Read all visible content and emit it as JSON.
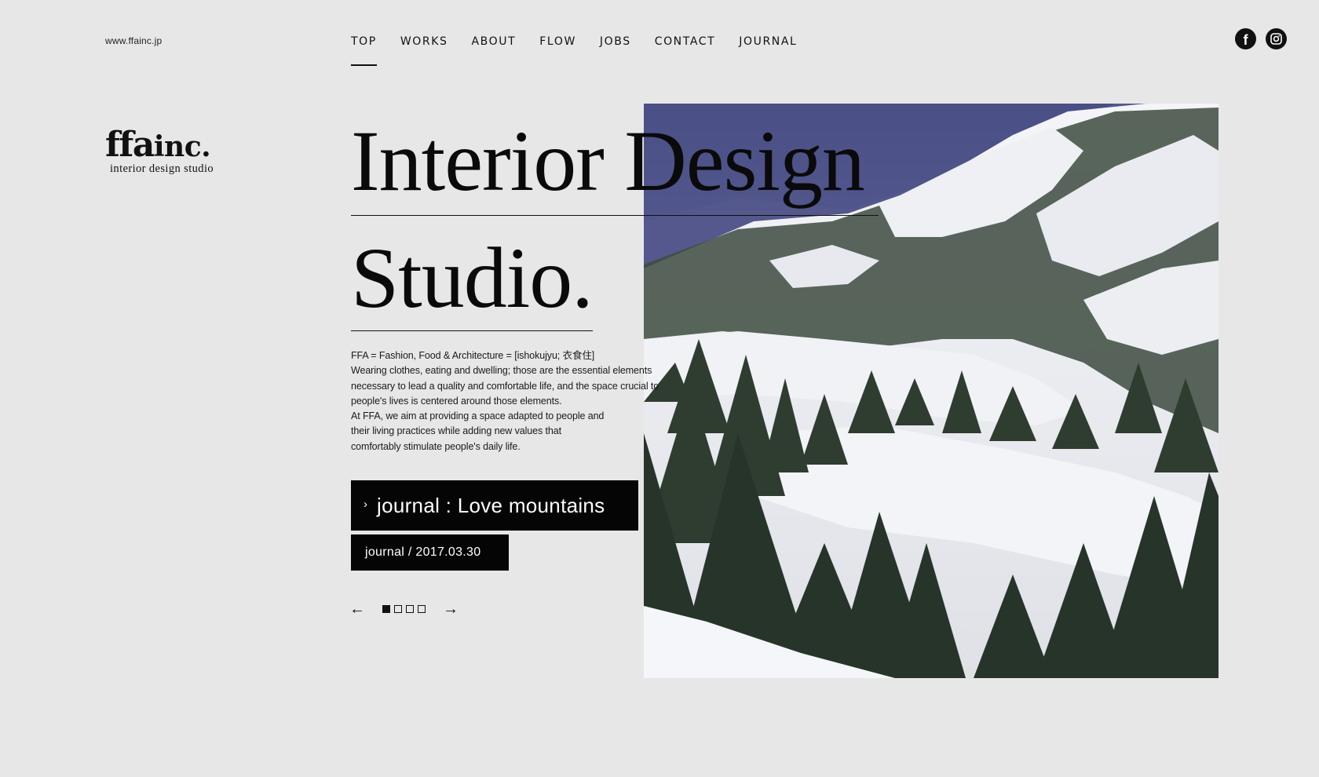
{
  "header": {
    "site_url": "www.ffainc.jp",
    "nav": [
      {
        "label": "TOP",
        "active": true
      },
      {
        "label": "WORKS"
      },
      {
        "label": "ABOUT"
      },
      {
        "label": "FLOW"
      },
      {
        "label": "JOBS"
      },
      {
        "label": "CONTACT"
      },
      {
        "label": "JOURNAL"
      }
    ],
    "social": [
      {
        "label": "f",
        "icon": "facebook-icon"
      },
      {
        "label": "",
        "icon": "instagram-icon"
      }
    ]
  },
  "logo": {
    "main": "ffa",
    "inc": "inc.",
    "sub": "interior design studio"
  },
  "hero": {
    "line1": "Interior Design",
    "line2": "Studio.",
    "photo": "snowy-mountain-forest-photo"
  },
  "intro": {
    "lines": [
      "FFA = Fashion, Food & Architecture = [ishokujyu; 衣食住]",
      "Wearing clothes, eating and dwelling; those are the essential elements",
      "necessary to lead a quality and comfortable life, and the space crucial to",
      "people's lives is centered around those elements.",
      "At FFA, we aim at providing a space adapted to people and",
      "their living practices while adding new values that",
      "comfortably stimulate people's daily life."
    ]
  },
  "journal": {
    "title": "journal : Love mountains",
    "meta": "journal / 2017.03.30",
    "chevron": "›"
  },
  "pager": {
    "prev": "←",
    "next": "→",
    "total": 4,
    "current": 1
  }
}
